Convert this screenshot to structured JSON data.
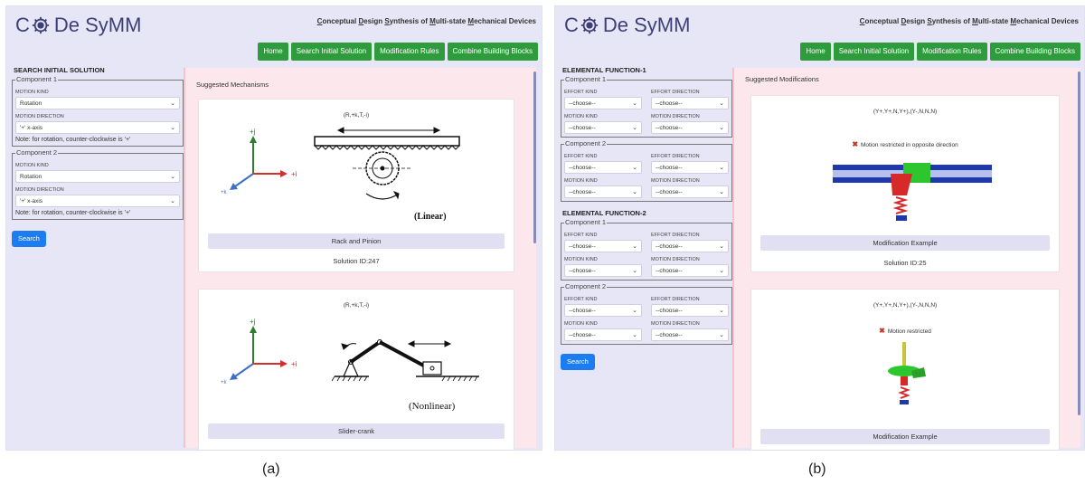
{
  "panel_a": {
    "logo": "De SyMM",
    "logo_letter": "C",
    "subtitle": {
      "parts": [
        {
          "t": "C",
          "u": true
        },
        {
          "t": "onceptual ",
          "u": false
        },
        {
          "t": "D",
          "u": true
        },
        {
          "t": "esign ",
          "u": false
        },
        {
          "t": "S",
          "u": true
        },
        {
          "t": "ynthesis of ",
          "u": false
        },
        {
          "t": "M",
          "u": true
        },
        {
          "t": "ulti-state ",
          "u": false
        },
        {
          "t": "M",
          "u": true
        },
        {
          "t": "echanical Devices",
          "u": false
        }
      ]
    },
    "nav": [
      "Home",
      "Search Initial Solution",
      "Modification Rules",
      "Combine Building Blocks"
    ],
    "sidebar_title": "SEARCH INITIAL SOLUTION",
    "components": [
      {
        "legend": "Component 1",
        "motion_kind_label": "MOTION KIND",
        "motion_kind_value": "Rotation",
        "motion_direction_label": "MOTION DIRECTION",
        "motion_direction_value": "'+' x-axis",
        "note": "Note: for rotation, counter-clockwise is '+'"
      },
      {
        "legend": "Component 2",
        "motion_kind_label": "MOTION KIND",
        "motion_kind_value": "Rotation",
        "motion_direction_label": "MOTION DIRECTION",
        "motion_direction_value": "'+' x-axis",
        "note": "Note: for rotation, counter-clockwise is '+'"
      }
    ],
    "search_button": "Search",
    "content_title": "Suggested Mechanisms",
    "cards": [
      {
        "equation": "(R,+k,T,-i)",
        "image_label": "(Linear)",
        "button": "Rack and Pinion",
        "solution_id": "Solution ID:247"
      },
      {
        "equation": "(R,+k,T,-i)",
        "image_label": "(Nonlinear)",
        "button": "Slider-crank"
      }
    ],
    "axis_labels": {
      "j": "+j",
      "i": "+i",
      "k": "+k"
    },
    "caption": "(a)"
  },
  "panel_b": {
    "logo": "De SyMM",
    "logo_letter": "C",
    "nav": [
      "Home",
      "Search Initial Solution",
      "Modification Rules",
      "Combine Building Blocks"
    ],
    "functions": [
      {
        "title": "ELEMENTAL FUNCTION-1",
        "components": [
          {
            "legend": "Component 1",
            "effort_kind": "EFFORT KIND",
            "effort_direction": "EFFORT DIRECTION",
            "motion_kind": "MOTION KIND",
            "motion_direction": "MOTION DIRECTION",
            "values": [
              "--choose--",
              "--choose--",
              "--choose--",
              "--choose--"
            ]
          },
          {
            "legend": "Component 2",
            "effort_kind": "EFFORT KIND",
            "effort_direction": "EFFORT DIRECTION",
            "motion_kind": "MOTION KIND",
            "motion_direction": "MOTION DIRECTION",
            "values": [
              "--choose--",
              "--choose--",
              "--choose--",
              "--choose--"
            ]
          }
        ]
      },
      {
        "title": "ELEMENTAL FUNCTION-2",
        "components": [
          {
            "legend": "Component 1",
            "effort_kind": "EFFORT KIND",
            "effort_direction": "EFFORT DIRECTION",
            "motion_kind": "MOTION KIND",
            "motion_direction": "MOTION DIRECTION",
            "values": [
              "--choose--",
              "--choose--",
              "--choose--",
              "--choose--"
            ]
          },
          {
            "legend": "Component 2",
            "effort_kind": "EFFORT KIND",
            "effort_direction": "EFFORT DIRECTION",
            "motion_kind": "MOTION KIND",
            "motion_direction": "MOTION DIRECTION",
            "values": [
              "--choose--",
              "--choose--",
              "--choose--",
              "--choose--"
            ]
          }
        ]
      }
    ],
    "search_button": "Search",
    "content_title": "Suggested Modifications",
    "cards": [
      {
        "equation": "(Y+,Y+,N,Y+),(Y-,N,N,N)",
        "status": "Motion restricted in opposite direction",
        "button": "Modification Example",
        "solution_id": "Solution ID:25"
      },
      {
        "equation": "(Y+,Y+,N,Y+),(Y-,N,N,N)",
        "status": "Motion restricted",
        "button": "Modification Example"
      }
    ],
    "caption": "(b)"
  },
  "colors": {
    "nav_green": "#2e9c3c",
    "search_blue": "#1b7df0",
    "panel_bg": "#e6e6f6",
    "content_bg": "#fce8ec",
    "cross_red": "#c03a22"
  },
  "icons": [
    "gear-icon",
    "chevron-down-icon",
    "cross-icon"
  ]
}
